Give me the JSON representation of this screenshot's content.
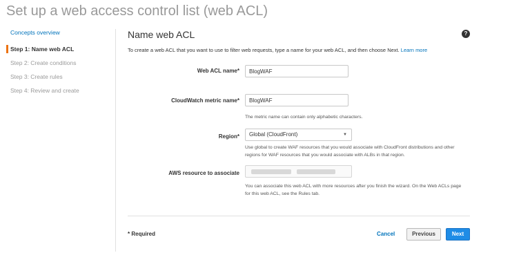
{
  "page": {
    "title": "Set up a web access control list (web ACL)"
  },
  "sidebar": {
    "overview_link": "Concepts overview",
    "steps": [
      {
        "label": "Step 1: Name web ACL",
        "active": true
      },
      {
        "label": "Step 2: Create conditions",
        "active": false
      },
      {
        "label": "Step 3: Create rules",
        "active": false
      },
      {
        "label": "Step 4: Review and create",
        "active": false
      }
    ]
  },
  "panel": {
    "title": "Name web ACL",
    "help_icon": "?",
    "intro": "To create a web ACL that you want to use to filter web requests, type a name for your web ACL, and then choose Next.",
    "learn_more": "Learn more"
  },
  "form": {
    "acl_name": {
      "label": "Web ACL name*",
      "value": "BlogWAF"
    },
    "metric_name": {
      "label": "CloudWatch metric name*",
      "value": "BlogWAF",
      "hint": "The metric name can contain only alphabetic characters."
    },
    "region": {
      "label": "Region*",
      "value": "Global (CloudFront)",
      "hint": "Use global to create WAF resources that you would associate with CloudFront distributions and other regions for WAF resources that you would associate with ALBs in that region."
    },
    "resource": {
      "label": "AWS resource to associate",
      "hint": "You can associate this web ACL with more resources after you finish the wizard. On the Web ACLs page for this web ACL, see the Rules tab."
    }
  },
  "footer": {
    "required": "* Required",
    "cancel": "Cancel",
    "previous": "Previous",
    "next": "Next"
  },
  "colors": {
    "accent_orange": "#ec7211",
    "link_blue": "#0073bb",
    "primary_button": "#1f8ce6"
  },
  "icons": {
    "help": "help-circle-icon",
    "select_caret": "caret-down-icon"
  }
}
